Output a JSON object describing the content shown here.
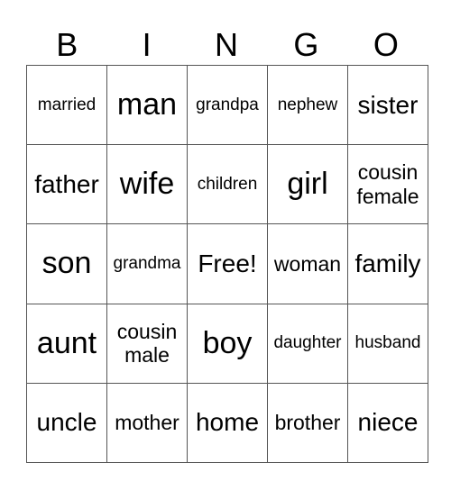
{
  "header": [
    "B",
    "I",
    "N",
    "G",
    "O"
  ],
  "rows": [
    [
      {
        "t": "married",
        "s": "s"
      },
      {
        "t": "man",
        "s": "xl"
      },
      {
        "t": "grandpa",
        "s": "s"
      },
      {
        "t": "nephew",
        "s": "s"
      },
      {
        "t": "sister",
        "s": "l"
      }
    ],
    [
      {
        "t": "father",
        "s": "l"
      },
      {
        "t": "wife",
        "s": "xl"
      },
      {
        "t": "children",
        "s": "s"
      },
      {
        "t": "girl",
        "s": "xl"
      },
      {
        "t": "cousin female",
        "s": "m"
      }
    ],
    [
      {
        "t": "son",
        "s": "xl"
      },
      {
        "t": "grandma",
        "s": "s"
      },
      {
        "t": "Free!",
        "s": "l"
      },
      {
        "t": "woman",
        "s": "m"
      },
      {
        "t": "family",
        "s": "l"
      }
    ],
    [
      {
        "t": "aunt",
        "s": "xl"
      },
      {
        "t": "cousin male",
        "s": "m"
      },
      {
        "t": "boy",
        "s": "xl"
      },
      {
        "t": "daughter",
        "s": "s"
      },
      {
        "t": "husband",
        "s": "s"
      }
    ],
    [
      {
        "t": "uncle",
        "s": "l"
      },
      {
        "t": "mother",
        "s": "m"
      },
      {
        "t": "home",
        "s": "l"
      },
      {
        "t": "brother",
        "s": "m"
      },
      {
        "t": "niece",
        "s": "l"
      }
    ]
  ]
}
